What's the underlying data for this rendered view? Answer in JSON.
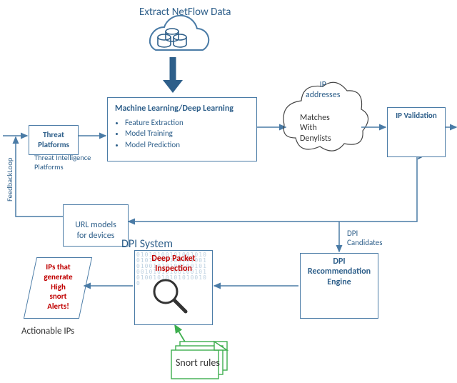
{
  "title_top": "Extract NetFlow Data",
  "threat_platforms": "Threat\nPlatforms",
  "tip_label": "Threat Intelligence\nPlatforms",
  "ml_box": {
    "title": "Machine  Learning/Deep Learning",
    "bullets": [
      "Feature Extraction",
      "Model Training",
      "Model Prediction"
    ]
  },
  "ip_addresses_label": "IP\naddresses",
  "denylist_cloud": "Matches\nWith\nDenylists",
  "ip_validation": "IP Validation",
  "feedback_loop": "FeedbackLoop",
  "url_models": "URL models\nfor devices",
  "dpi_system_label": "DPI System",
  "dpi_candidates_label": "DPI\nCandidates",
  "dpi_engine": "DPI\nRecommendation\nEngine",
  "dpi_box": "Deep Packet\nInspection",
  "snort_rules": "Snort rules",
  "actionable_ips_label": "Actionable IPs",
  "alerts_parallelogram": "IPs that\ngenerate\nHigh\nsnort\nAlerts!",
  "binary_filler": "01010100101001010010101001001010010100101010010010100101010100100101010010101010100100"
}
